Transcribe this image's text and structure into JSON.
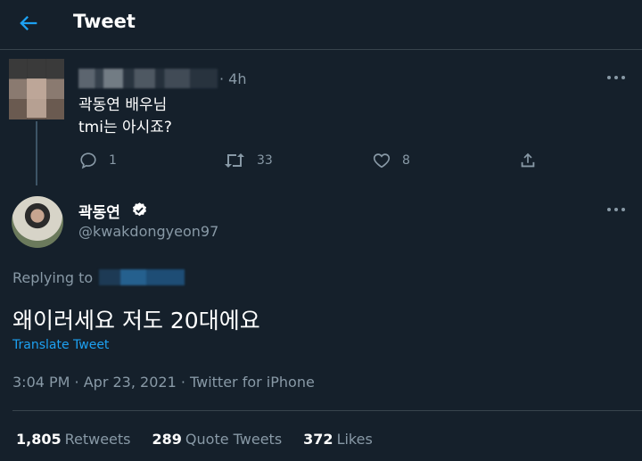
{
  "header": {
    "title": "Tweet",
    "back_icon": "back-arrow-icon",
    "accent": "#1da1f2"
  },
  "parent_tweet": {
    "time": "· 4h",
    "text_line1": "곽동연 배우님",
    "text_line2": "tmi는 아시죠?",
    "replies": "1",
    "retweets": "33",
    "likes": "8"
  },
  "main_tweet": {
    "name": "곽동연",
    "handle": "@kwakdongyeon97",
    "replying_label": "Replying to",
    "text": "왜이러세요 저도 20대에요",
    "translate_label": "Translate Tweet",
    "meta": "3:04 PM · Apr 23, 2021 · Twitter for iPhone",
    "stats": {
      "retweets_count": "1,805",
      "retweets_label": "Retweets",
      "quotes_count": "289",
      "quotes_label": "Quote Tweets",
      "likes_count": "372",
      "likes_label": "Likes"
    }
  }
}
